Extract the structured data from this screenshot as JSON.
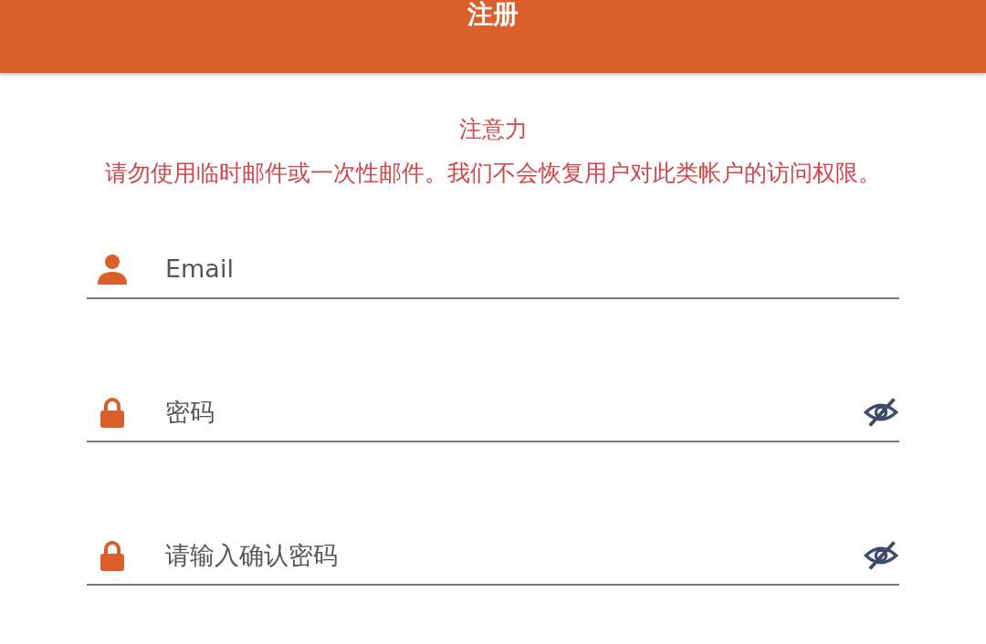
{
  "header": {
    "title": "注册"
  },
  "notice": {
    "heading": "注意力",
    "message": "请勿使用临时邮件或一次性邮件。我们不会恢复用户对此类帐户的访问权限。"
  },
  "fields": [
    {
      "kind": "email",
      "placeholder": "Email"
    },
    {
      "kind": "password",
      "placeholder": "密码"
    },
    {
      "kind": "password",
      "placeholder": "请输入确认密码"
    }
  ]
}
